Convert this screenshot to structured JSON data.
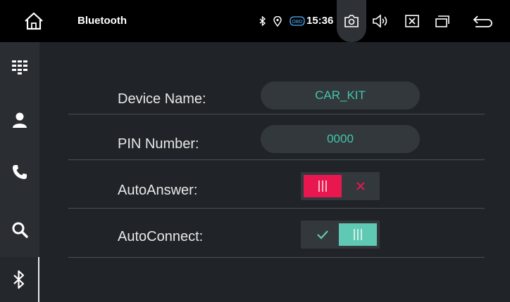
{
  "header": {
    "title": "Bluetooth",
    "time": "15:36",
    "obd_label": "OBD",
    "icons": [
      "home-icon",
      "bluetooth-icon",
      "location-icon",
      "obd-icon",
      "screenshot-icon",
      "volume-icon",
      "close-window-icon",
      "recent-apps-icon",
      "back-icon"
    ]
  },
  "sidebar": {
    "items": [
      {
        "name": "dialpad",
        "icon": "dialpad-icon",
        "active": false
      },
      {
        "name": "contacts",
        "icon": "person-icon",
        "active": false
      },
      {
        "name": "call-log",
        "icon": "phone-icon",
        "active": false
      },
      {
        "name": "search",
        "icon": "search-icon",
        "active": false
      },
      {
        "name": "bluetooth",
        "icon": "bluetooth-icon",
        "active": true
      }
    ]
  },
  "settings": {
    "device_name_label": "Device Name:",
    "device_name_value": "CAR_KIT",
    "pin_label": "PIN Number:",
    "pin_value": "0000",
    "auto_answer_label": "AutoAnswer:",
    "auto_answer_enabled": false,
    "auto_connect_label": "AutoConnect:",
    "auto_connect_enabled": true
  },
  "colors": {
    "accent_teal": "#3fc7a9",
    "accent_red": "#e8174f",
    "toggle_on": "#5fc9b4",
    "background": "#202428"
  }
}
